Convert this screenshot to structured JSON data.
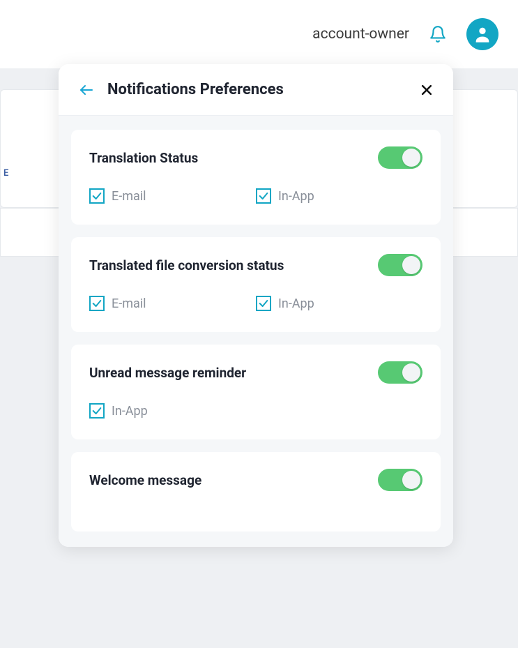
{
  "header": {
    "account_label": "account-owner"
  },
  "background": {
    "truncated_tab": "E"
  },
  "modal": {
    "title": "Notifications Preferences",
    "groups": [
      {
        "title": "Translation Status",
        "channels": {
          "email": "E-mail",
          "inapp": "In-App"
        }
      },
      {
        "title": "Translated file conversion status",
        "channels": {
          "email": "E-mail",
          "inapp": "In-App"
        }
      },
      {
        "title": "Unread message reminder",
        "channels": {
          "inapp": "In-App"
        }
      },
      {
        "title": "Welcome message"
      }
    ]
  },
  "colors": {
    "accent": "#12a6c4",
    "toggle_on": "#57c973"
  }
}
